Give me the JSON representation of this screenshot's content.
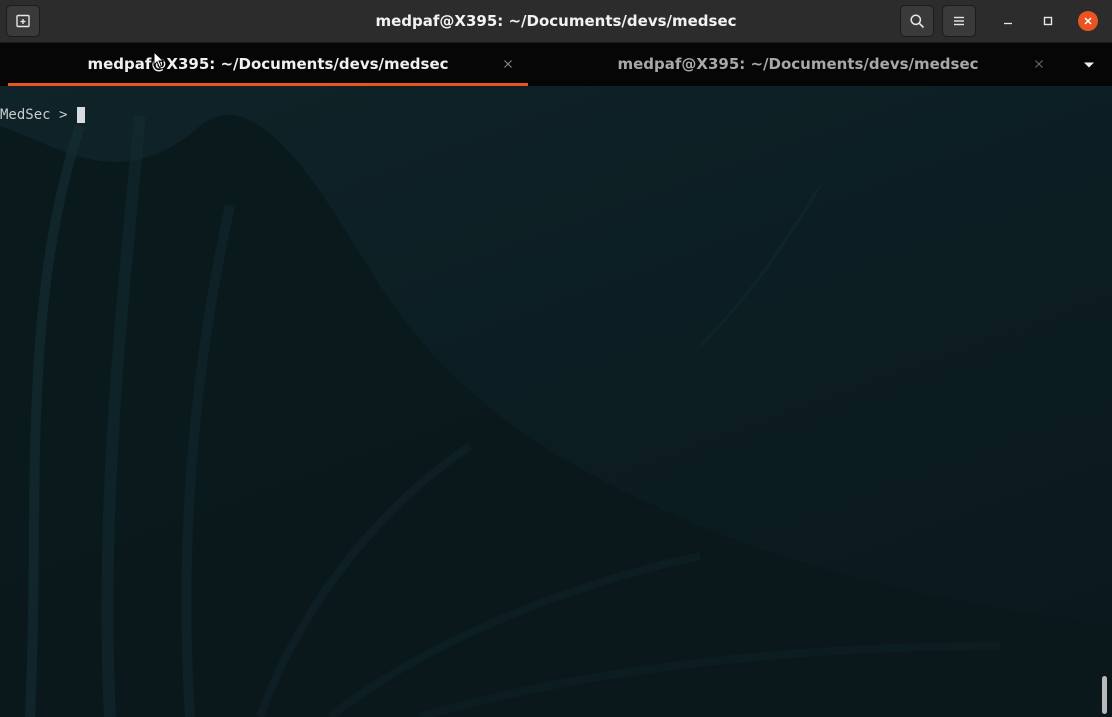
{
  "window": {
    "title": "medpaf@X395: ~/Documents/devs/medsec"
  },
  "tabs": [
    {
      "label": "medpaf@X395: ~/Documents/devs/medsec",
      "active": true
    },
    {
      "label": "medpaf@X395: ~/Documents/devs/medsec",
      "active": false
    }
  ],
  "terminal": {
    "prompt": "MedSec > "
  },
  "colors": {
    "accent": "#e95420",
    "titlebar": "#2c2c2c",
    "tabbar": "#060606",
    "terminal_bg": "#0c1c21"
  },
  "icons": {
    "new_tab": "new-tab-icon",
    "search": "search-icon",
    "menu": "hamburger-menu-icon",
    "minimize": "minimize-icon",
    "maximize": "maximize-icon",
    "close": "close-icon",
    "tab_close": "close-icon",
    "tabs_dropdown": "chevron-down-icon"
  }
}
